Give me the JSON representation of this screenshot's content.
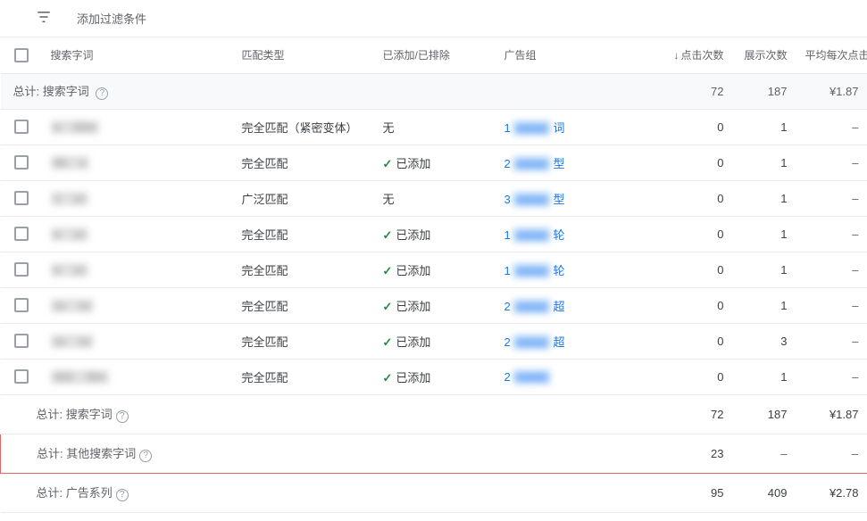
{
  "filter": {
    "label": "添加过滤条件"
  },
  "columns": {
    "term": "搜索字词",
    "match": "匹配类型",
    "added": "已添加/已排除",
    "group": "广告组",
    "clicks": "点击次数",
    "impr": "展示次数",
    "cpc": "平均每次点击"
  },
  "totals_top": {
    "label": "总计: 搜索字词",
    "clicks": "72",
    "impr": "187",
    "cpc": "¥1.87"
  },
  "status": {
    "none": "无",
    "added": "已添加"
  },
  "rows": [
    {
      "term_a": "e",
      "term_b": "00m",
      "match": "完全匹配（紧密变体）",
      "added": "none",
      "grp_a": "1",
      "grp_b": "词",
      "clicks": "0",
      "impr": "1",
      "cpc": "–"
    },
    {
      "term_a": "90",
      "term_b": "s",
      "match": "完全匹配",
      "added": "added",
      "grp_a": "2",
      "grp_b": "型",
      "clicks": "0",
      "impr": "1",
      "cpc": "–"
    },
    {
      "term_a": "1",
      "term_b": "",
      "match": "广泛匹配",
      "added": "none",
      "grp_a": "3",
      "grp_b": "型",
      "clicks": "0",
      "impr": "1",
      "cpc": "–"
    },
    {
      "term_a": "e",
      "term_b": "",
      "match": "完全匹配",
      "added": "added",
      "grp_a": "1",
      "grp_b": "轮",
      "clicks": "0",
      "impr": "1",
      "cpc": "–"
    },
    {
      "term_a": "e",
      "term_b": "",
      "match": "完全匹配",
      "added": "added",
      "grp_a": "1",
      "grp_b": "轮",
      "clicks": "0",
      "impr": "1",
      "cpc": "–"
    },
    {
      "term_a": "",
      "term_b": "",
      "match": "完全匹配",
      "added": "added",
      "grp_a": "2",
      "grp_b": "超",
      "clicks": "0",
      "impr": "1",
      "cpc": "–"
    },
    {
      "term_a": "",
      "term_b": "",
      "match": "完全匹配",
      "added": "added",
      "grp_a": "2",
      "grp_b": "超",
      "clicks": "0",
      "impr": "3",
      "cpc": "–"
    },
    {
      "term_a": "002",
      "term_b": "30s",
      "match": "完全匹配",
      "added": "added",
      "grp_a": "2",
      "grp_b": "",
      "clicks": "0",
      "impr": "1",
      "cpc": "–"
    }
  ],
  "footers": {
    "search_terms": {
      "label": "总计: 搜索字词",
      "clicks": "72",
      "impr": "187",
      "cpc": "¥1.87"
    },
    "other": {
      "label": "总计: 其他搜索字词",
      "clicks": "23",
      "impr": "–",
      "cpc": "–"
    },
    "campaign": {
      "label": "总计: 广告系列",
      "clicks": "95",
      "impr": "409",
      "cpc": "¥2.78"
    }
  }
}
